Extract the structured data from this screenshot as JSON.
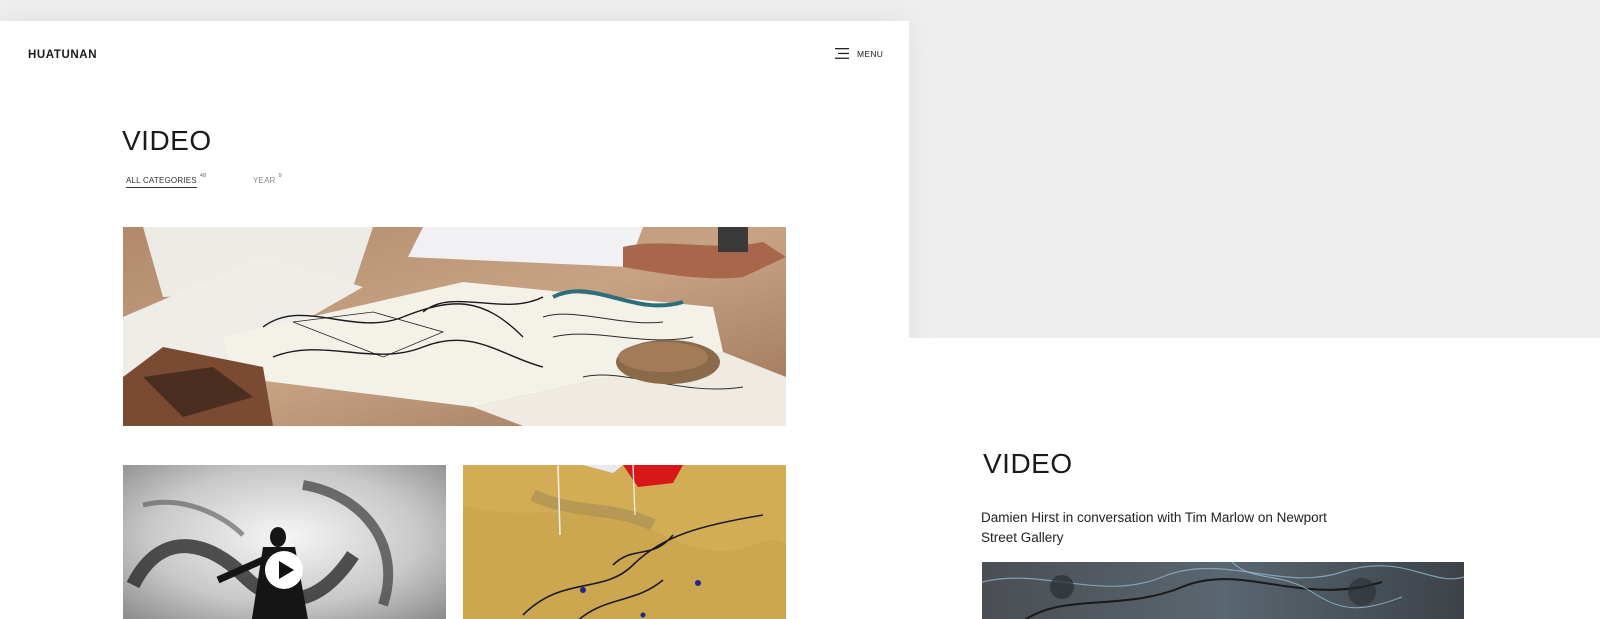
{
  "header": {
    "logo": "HUATUNAN",
    "menu_label": "MENU",
    "menu_icon": "hamburger-menu-icon"
  },
  "main": {
    "title": "VIDEO",
    "filters": [
      {
        "label": "ALL CATEGORIES",
        "count": "48",
        "active": true
      },
      {
        "label": "YEAR",
        "count": "9",
        "active": false
      }
    ],
    "thumbnails": [
      {
        "subject": "sketchbook-drawings-on-table"
      },
      {
        "subject": "artist-painting-black-brushstrokes",
        "has_play_button": true,
        "play_icon": "play-icon"
      },
      {
        "subject": "yellow-abstract-painting"
      }
    ]
  },
  "detail": {
    "title": "VIDEO",
    "description": "Damien Hirst in conversation with Tim Marlow on Newport Street Gallery",
    "thumbnail": {
      "subject": "dark-abstract-painting"
    }
  },
  "colors": {
    "background": "#eeeeee",
    "panel": "#ffffff",
    "text": "#1a1a1a",
    "muted": "#888888"
  }
}
